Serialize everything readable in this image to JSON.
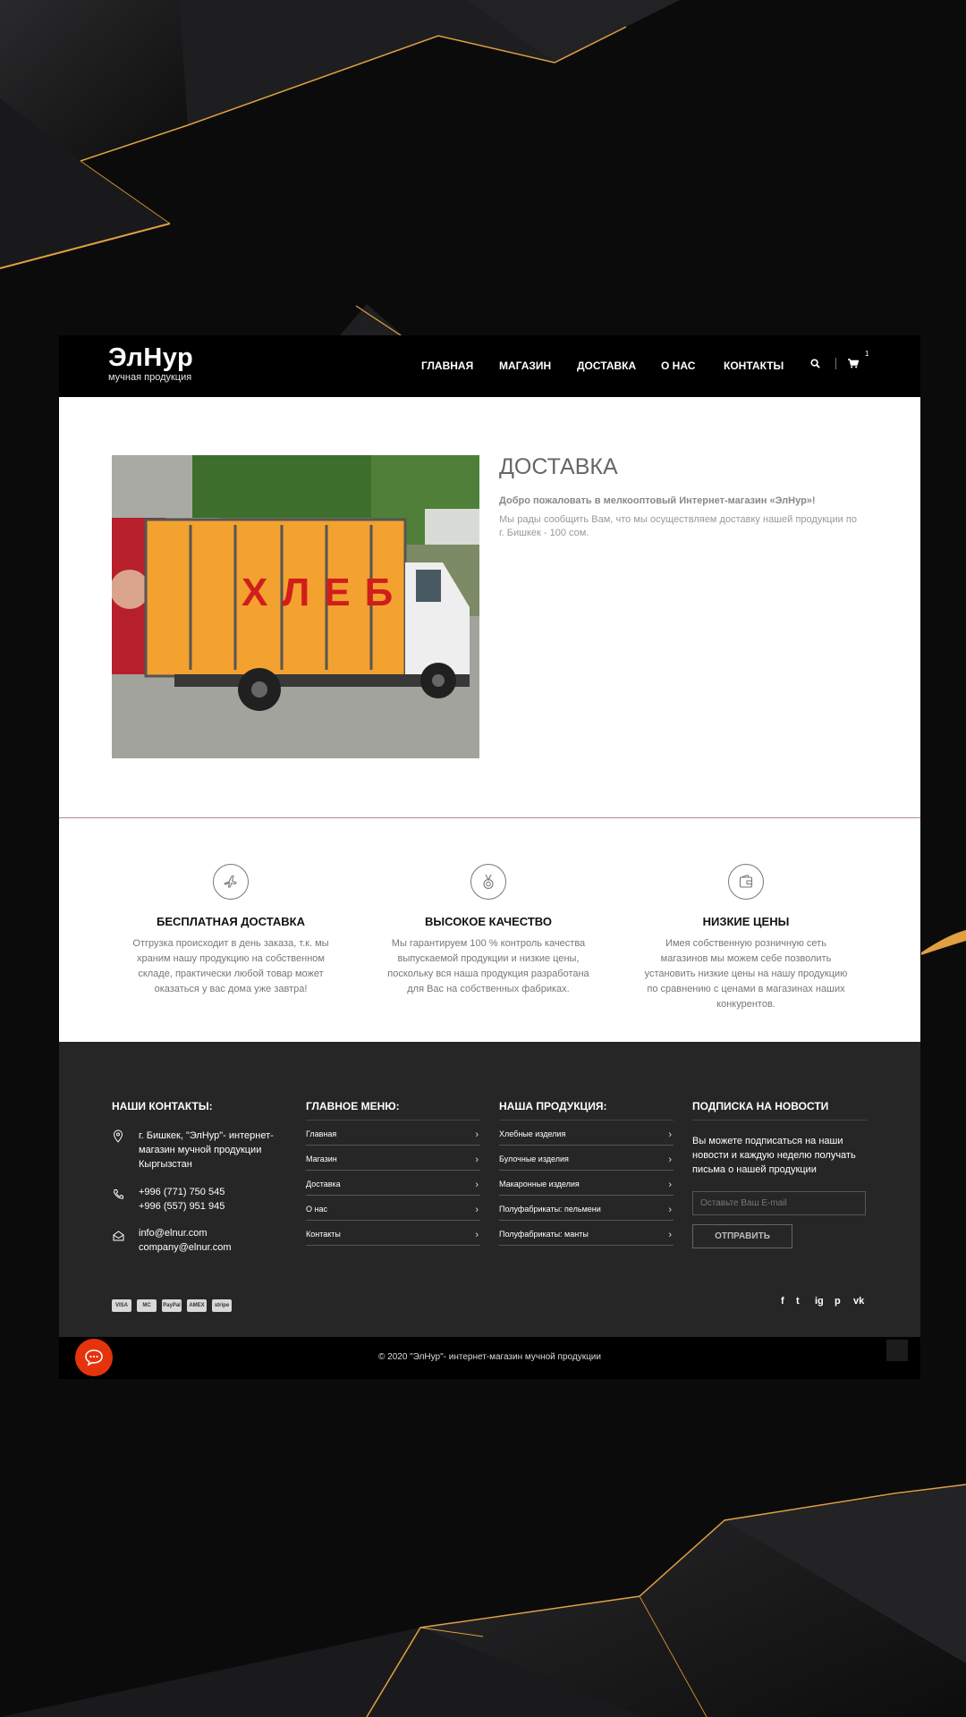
{
  "header": {
    "logo_title": "ЭлНур",
    "logo_subtitle": "мучная продукция",
    "nav": [
      "ГЛАВНАЯ",
      "МАГАЗИН",
      "ДОСТАВКА",
      "О НАС",
      "КОНТАКТЫ"
    ],
    "cart_count": "1",
    "icons": [
      "search-icon",
      "cart-icon"
    ]
  },
  "delivery": {
    "title": "ДОСТАВКА",
    "intro": "Добро пожаловать в мелкооптовый Интернет-магазин «ЭлНур»!",
    "text": "Мы рады сообщить Вам, что мы осуществляем доставку нашей продукции по г. Бишкек - 100 сом.",
    "image_text": "ХЛЕБ"
  },
  "features": [
    {
      "icon": "airplane-icon",
      "title": "БЕСПЛАТНАЯ ДОСТАВКА",
      "text": "Отгрузка происходит в день заказа, т.к. мы храним нашу продукцию на собственном складе, практически любой товар может оказаться у вас дома уже завтра!"
    },
    {
      "icon": "medal-icon",
      "title": "ВЫСОКОЕ КАЧЕСТВО",
      "text": "Мы гарантируем 100 % контроль качества выпускаемой продукции и низкие цены, поскольку вся наша продукция разработана для Вас на собственных фабриках."
    },
    {
      "icon": "wallet-icon",
      "title": "НИЗКИЕ ЦЕНЫ",
      "text": "Имея собственную розничную сеть магазинов мы можем себе позволить установить низкие цены на нашу продукцию по сравнению с ценами в магазинах наших конкурентов."
    }
  ],
  "footer": {
    "contacts": {
      "heading": "НАШИ КОНТАКТЫ:",
      "address": "г. Бишкек, \"ЭлНур\"- интернет-магазин мучной продукции Кыргызстан",
      "phone1": "+996 (771) 750 545",
      "phone2": "+996 (557) 951 945",
      "email1": "info@elnur.com",
      "email2": "company@elnur.com"
    },
    "menu": {
      "heading": "ГЛАВНОЕ МЕНЮ:",
      "items": [
        "Главная",
        "Магазин",
        "Доставка",
        "О нас",
        "Контакты"
      ]
    },
    "products": {
      "heading": "НАША ПРОДУКЦИЯ:",
      "items": [
        "Хлебные изделия",
        "Булочные изделия",
        "Макаронные изделия",
        "Полуфабрикаты: пельмени",
        "Полуфабрикаты: манты"
      ]
    },
    "newsletter": {
      "heading": "ПОДПИСКА НА НОВОСТИ",
      "text": "Вы можете подписаться на наши новости и каждую неделю получать письма о нашей продукции",
      "placeholder": "Оставьте Ваш E-mail",
      "button": "ОТПРАВИТЬ"
    },
    "payments": [
      "VISA",
      "MC",
      "PayPal",
      "AMEX",
      "stripe"
    ],
    "social": [
      "f",
      "t",
      "ig",
      "p",
      "vk"
    ],
    "copyright": "© 2020 \"ЭлНур\"- интернет-магазин мучной продукции"
  },
  "colors": {
    "accent_gold": "#e0a040",
    "chat_button": "#e4330d",
    "footer_bg": "#262626"
  }
}
